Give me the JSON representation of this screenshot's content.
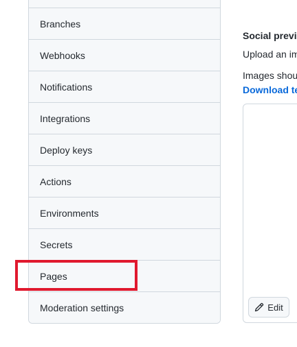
{
  "sidebar": {
    "items": [
      {
        "label": ""
      },
      {
        "label": "Branches"
      },
      {
        "label": "Webhooks"
      },
      {
        "label": "Notifications"
      },
      {
        "label": "Integrations"
      },
      {
        "label": "Deploy keys"
      },
      {
        "label": "Actions"
      },
      {
        "label": "Environments"
      },
      {
        "label": "Secrets"
      },
      {
        "label": "Pages"
      },
      {
        "label": "Moderation settings"
      }
    ]
  },
  "social_preview": {
    "title": "Social previe",
    "upload_text": "Upload an im",
    "guideline_text": "Images shou",
    "download_link": "Download te",
    "edit_label": "Edit",
    "edit_icon": "pencil-icon"
  },
  "highlight": {
    "color": "#e0192e",
    "target": "Pages"
  }
}
